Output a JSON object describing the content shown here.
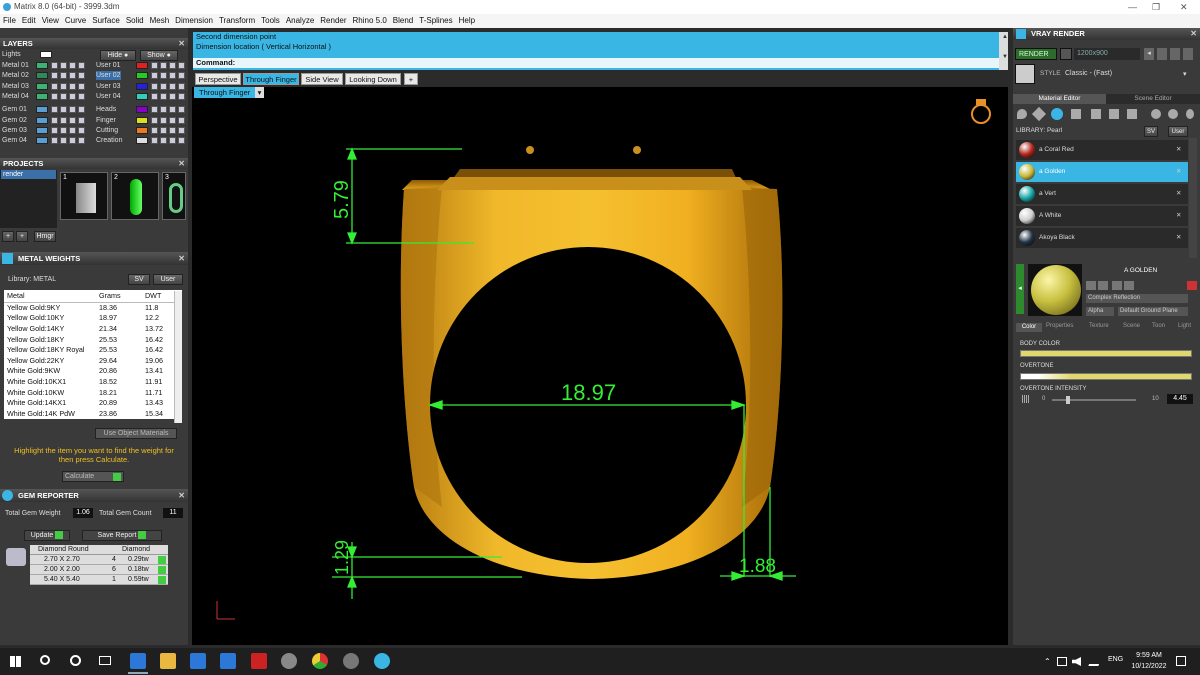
{
  "window": {
    "title": "Matrix 8.0 (64-bit) - 3999.3dm"
  },
  "menu": [
    "File",
    "Edit",
    "View",
    "Curve",
    "Surface",
    "Solid",
    "Mesh",
    "Dimension",
    "Transform",
    "Tools",
    "Analyze",
    "Render",
    "Rhino 5.0",
    "Blend",
    "T-Splines",
    "Help"
  ],
  "layers": {
    "title": "LAYERS",
    "lights": "Lights",
    "hide": "Hide",
    "show": "Show",
    "left": [
      {
        "name": "Metal 01",
        "color": "#3cb371"
      },
      {
        "name": "Metal 02",
        "color": "#2e8b57"
      },
      {
        "name": "Metal 03",
        "color": "#3cb371"
      },
      {
        "name": "Metal 04",
        "color": "#3cb371"
      },
      {
        "name": "Gem 01",
        "color": "#5a9fd4"
      },
      {
        "name": "Gem 02",
        "color": "#5a9fd4"
      },
      {
        "name": "Gem 03",
        "color": "#5a9fd4"
      },
      {
        "name": "Gem 04",
        "color": "#5a9fd4"
      }
    ],
    "right": [
      {
        "name": "User 01",
        "color": "#d22"
      },
      {
        "name": "User 02",
        "color": "#2c2"
      },
      {
        "name": "User 03",
        "color": "#22d"
      },
      {
        "name": "User 04",
        "color": "#3cb"
      },
      {
        "name": "Heads",
        "color": "#80c"
      },
      {
        "name": "Finger",
        "color": "#dd2"
      },
      {
        "name": "Cutting",
        "color": "#e72"
      },
      {
        "name": "Creation",
        "color": "#ddd"
      }
    ]
  },
  "projects": {
    "title": "PROJECTS",
    "item": "render",
    "thumbs": [
      "1",
      "2",
      "3"
    ],
    "btn": "Hmgr"
  },
  "metal": {
    "title": "METAL WEIGHTS",
    "library": "Library: METAL",
    "sv": "SV",
    "user": "User",
    "headers": [
      "Metal",
      "Grams",
      "DWT"
    ],
    "rows": [
      [
        "Yellow Gold:9KY",
        "18.36",
        "11.8"
      ],
      [
        "Yellow Gold:10KY",
        "18.97",
        "12.2"
      ],
      [
        "Yellow Gold:14KY",
        "21.34",
        "13.72"
      ],
      [
        "Yellow Gold:18KY",
        "25.53",
        "16.42"
      ],
      [
        "Yellow Gold:18KY Royal",
        "25.53",
        "16.42"
      ],
      [
        "Yellow Gold:22KY",
        "29.64",
        "19.06"
      ],
      [
        "White Gold:9KW",
        "20.86",
        "13.41"
      ],
      [
        "White Gold:10KX1",
        "18.52",
        "11.91"
      ],
      [
        "White Gold:10KW",
        "18.21",
        "11.71"
      ],
      [
        "White Gold:14KX1",
        "20.89",
        "13.43"
      ],
      [
        "White Gold:14K PdW",
        "23.86",
        "15.34"
      ]
    ],
    "use_object": "Use Object Materials",
    "hint": "Highlight the item you want to find the weight for then press Calculate.",
    "calculate": "Calculate"
  },
  "gem": {
    "title": "GEM REPORTER",
    "total_weight_label": "Total Gem Weight",
    "total_weight": "1.06",
    "total_count_label": "Total Gem Count",
    "total_count": "11",
    "update": "Update",
    "save": "Save Report",
    "headers": [
      "Diamond Round",
      "Diamond"
    ],
    "rows": [
      [
        "2.70 X 2.70",
        "4",
        "0.29tw"
      ],
      [
        "2.00 X 2.00",
        "6",
        "0.18tw"
      ],
      [
        "5.40 X 5.40",
        "1",
        "0.59tw"
      ]
    ]
  },
  "command": {
    "line1": "Second dimension point",
    "line2": "Dimension location ( Vertical  Horizontal )",
    "prompt": "Command:"
  },
  "tabs": [
    "Perspective",
    "Through Finger",
    "Side View",
    "Looking Down",
    "+"
  ],
  "active_view": "Through Finger",
  "dims": {
    "top": "5.79",
    "inner": "18.97",
    "bottom": "1.29",
    "side": "1.88"
  },
  "vray": {
    "title": "VRAY RENDER",
    "render": "RENDER",
    "size": "1200x900",
    "style_label": "STYLE",
    "style": "Classic - (Fast)",
    "tab1": "Material Editor",
    "tab2": "Scene Editor",
    "library": "LIBRARY: Pearl",
    "sv": "SV",
    "user": "User",
    "materials": [
      {
        "name": "a Coral Red",
        "color": "#b3261e"
      },
      {
        "name": "a Golden",
        "color": "#c8b83a"
      },
      {
        "name": "a Vert",
        "color": "#17a6a6"
      },
      {
        "name": "A White",
        "color": "#cfcfcf"
      },
      {
        "name": "Akoya Black",
        "color": "#223344"
      }
    ],
    "selected_name": "A GOLDEN",
    "reflection": "Complex Reflection",
    "alpha": "Alpha",
    "groundplane": "Default Ground Plane",
    "subtabs": [
      "Color",
      "Properties",
      "Texture",
      "Scene",
      "Toon",
      "Light"
    ],
    "body_color": "BODY COLOR",
    "overtone": "OVERTONE",
    "intensity": "OVERTONE INTENSITY",
    "int_min": "0",
    "int_max": "10",
    "int_val": "4.45"
  },
  "taskbar": {
    "time": "9:59 AM",
    "date": "10/12/2022",
    "lang": "ENG"
  }
}
